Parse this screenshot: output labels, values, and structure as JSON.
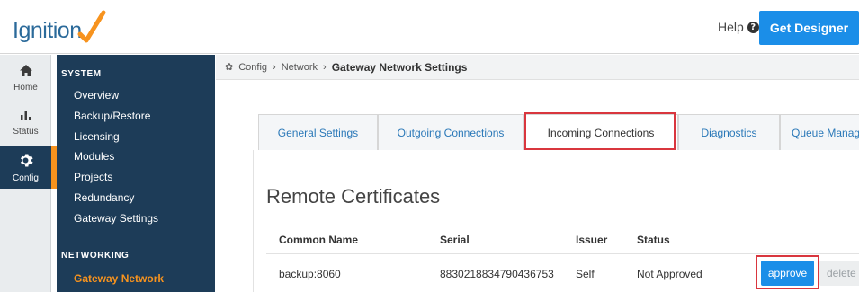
{
  "header": {
    "logo_text": "Ignition",
    "help_label": "Help",
    "get_designer_label": "Get Designer"
  },
  "rail": {
    "items": [
      {
        "label": "Home",
        "icon": "home-icon",
        "glyph": "⌂"
      },
      {
        "label": "Status",
        "icon": "status-bars-icon",
        "glyph": "▃▅"
      },
      {
        "label": "Config",
        "icon": "gear-icon",
        "glyph": "✿"
      }
    ]
  },
  "sidenav": {
    "sections": [
      {
        "title": "SYSTEM",
        "items": [
          "Overview",
          "Backup/Restore",
          "Licensing",
          "Modules",
          "Projects",
          "Redundancy",
          "Gateway Settings"
        ]
      },
      {
        "title": "NETWORKING",
        "items": [
          "Gateway Network"
        ]
      }
    ]
  },
  "breadcrumb": {
    "items": [
      "Config",
      "Network",
      "Gateway Network Settings"
    ]
  },
  "tabs": [
    "General Settings",
    "Outgoing Connections",
    "Incoming Connections",
    "Diagnostics",
    "Queue Manage"
  ],
  "active_tab": "Incoming Connections",
  "content": {
    "title": "Remote Certificates",
    "columns": [
      "Common Name",
      "Serial",
      "Issuer",
      "Status"
    ],
    "rows": [
      {
        "common_name": "backup:8060",
        "serial": "8830218834790436753",
        "issuer": "Self",
        "status": "Not Approved",
        "approve_label": "approve",
        "delete_label": "delete"
      }
    ]
  },
  "colors": {
    "accent_blue": "#1b8ee8",
    "nav_bg": "#1d3c58",
    "nav_active": "#f7931e",
    "highlight_red": "#d9363e"
  }
}
